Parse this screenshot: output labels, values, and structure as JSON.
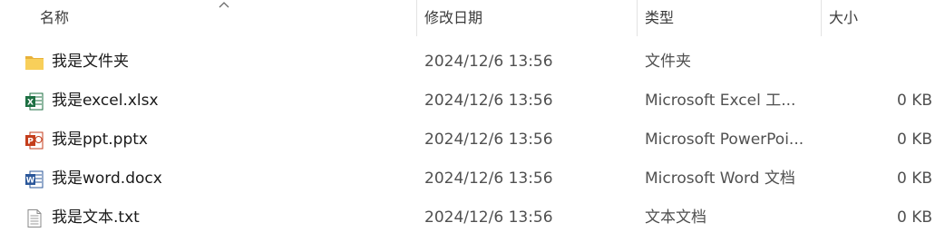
{
  "columns": {
    "name": "名称",
    "modified": "修改日期",
    "type": "类型",
    "size": "大小"
  },
  "files": [
    {
      "icon": "folder-icon",
      "name": "我是文件夹",
      "modified": "2024/12/6 13:56",
      "type": "文件夹",
      "size": ""
    },
    {
      "icon": "excel-file-icon",
      "name": "我是excel.xlsx",
      "modified": "2024/12/6 13:56",
      "type": "Microsoft Excel 工...",
      "size": "0 KB"
    },
    {
      "icon": "powerpoint-file-icon",
      "name": "我是ppt.pptx",
      "modified": "2024/12/6 13:56",
      "type": "Microsoft PowerPoi...",
      "size": "0 KB"
    },
    {
      "icon": "word-file-icon",
      "name": "我是word.docx",
      "modified": "2024/12/6 13:56",
      "type": "Microsoft Word 文档",
      "size": "0 KB"
    },
    {
      "icon": "text-file-icon",
      "name": "我是文本.txt",
      "modified": "2024/12/6 13:56",
      "type": "文本文档",
      "size": "0 KB"
    }
  ],
  "colors": {
    "folder": "#f4c542",
    "excel": "#1d6f42",
    "powerpoint": "#c43e1c",
    "word": "#2b579a",
    "text": "#8a8a8a"
  }
}
